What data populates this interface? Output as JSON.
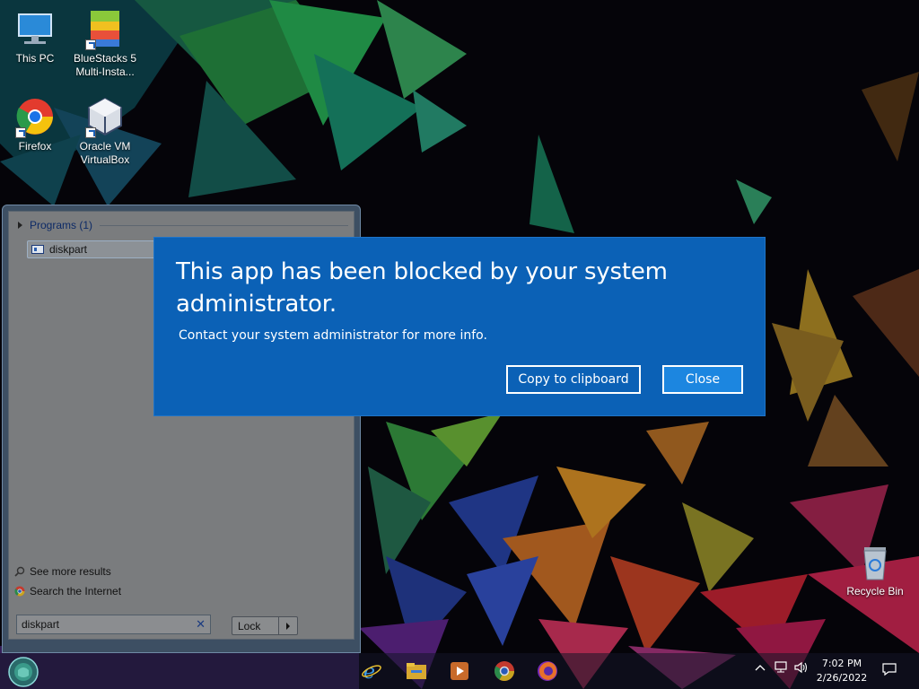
{
  "desktop": {
    "icons": [
      {
        "label": "This PC",
        "icon": "computer-icon"
      },
      {
        "label": "BlueStacks 5 Multi-Insta...",
        "icon": "bluestacks-icon"
      },
      {
        "label": "Firefox",
        "icon": "chrome-icon"
      },
      {
        "label": "Oracle VM VirtualBox",
        "icon": "virtualbox-icon"
      },
      {
        "label": "Recycle Bin",
        "icon": "recycle-bin-icon"
      }
    ]
  },
  "start_menu": {
    "programs_header": "Programs (1)",
    "program_item": "diskpart",
    "see_more": "See more results",
    "search_internet": "Search the Internet",
    "search_value": "diskpart",
    "search_clear": "✕",
    "lock_label": "Lock"
  },
  "dialog": {
    "title": "This app has been blocked by your system administrator.",
    "body": "Contact your system administrator for more info.",
    "copy_button": "Copy to clipboard",
    "close_button": "Close"
  },
  "taskbar": {
    "apps": [
      "internet-explorer-icon",
      "file-explorer-icon",
      "media-player-icon",
      "chrome-icon",
      "firefox-icon"
    ],
    "time": "7:02 PM",
    "date": "2/26/2022"
  }
}
